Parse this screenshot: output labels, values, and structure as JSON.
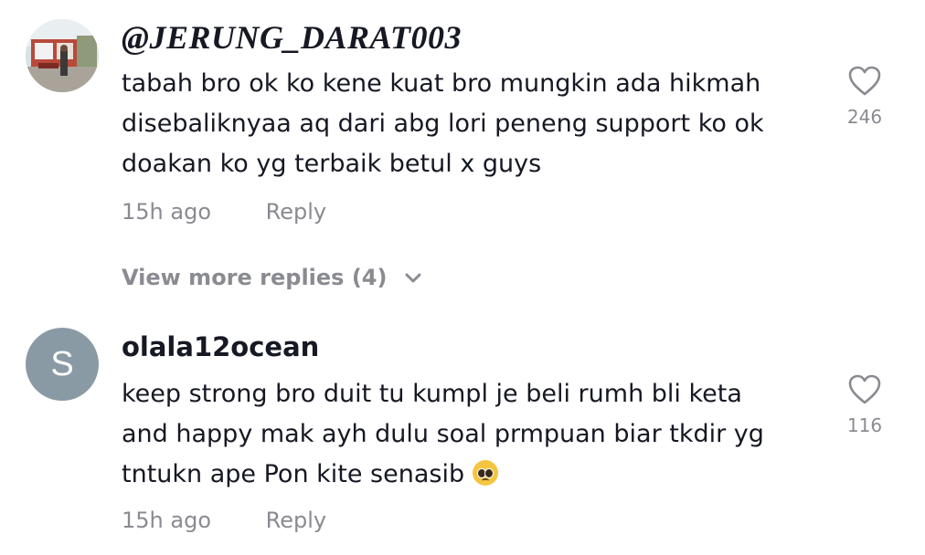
{
  "comments": [
    {
      "username": "@JERUNG_DARAT003",
      "text_lines": [
        "tabah bro ok ko kene kuat bro mungkin ada hikmah",
        "disebaliknyaa aq dari abg lori peneng support ko ok",
        "doakan ko yg terbaik betul x guys"
      ],
      "time": "15h ago",
      "reply_label": "Reply",
      "likes": "246",
      "avatar": "photo"
    },
    {
      "username": "olala12ocean",
      "avatar_letter": "S",
      "text_lines": [
        "keep strong bro duit tu kumpl je beli rumh bli keta",
        "and happy mak ayh dulu soal prmpuan biar tkdir yg",
        "tntukn ape Pon kite senasib"
      ],
      "emoji": "pleading-face-emoji",
      "time": "15h ago",
      "reply_label": "Reply",
      "likes": "116"
    }
  ],
  "view_more_replies": "View more replies (4)",
  "colors": {
    "text": "#161823",
    "muted": "#8a8b91",
    "avatar_bg": "#8a9aa5"
  }
}
